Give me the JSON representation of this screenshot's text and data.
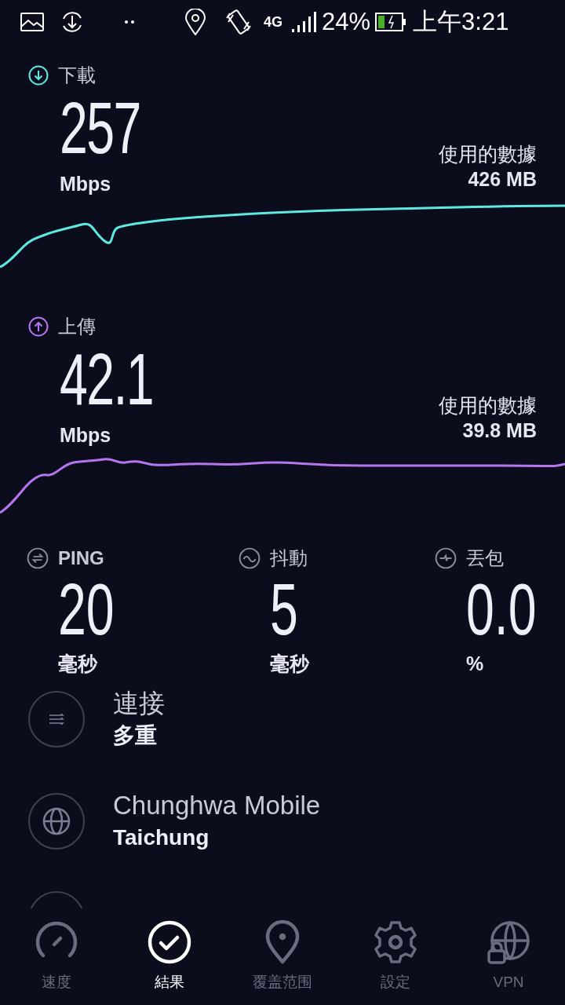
{
  "status_bar": {
    "network": "4G",
    "battery_percent": "24%",
    "time": "上午3:21"
  },
  "download": {
    "label": "下載",
    "value": "257",
    "unit": "Mbps",
    "data_label": "使用的數據",
    "data_value": "426 MB"
  },
  "upload": {
    "label": "上傳",
    "value": "42.1",
    "unit": "Mbps",
    "data_label": "使用的數據",
    "data_value": "39.8 MB"
  },
  "stats": [
    {
      "kind": "ping",
      "label": "PING",
      "value": "20",
      "unit": "毫秒"
    },
    {
      "kind": "jitter",
      "label": "抖動",
      "value": "5",
      "unit": "毫秒"
    },
    {
      "kind": "loss",
      "label": "丟包",
      "value": "0.0",
      "unit": "%"
    }
  ],
  "details": [
    {
      "kind": "connections",
      "title": "連接",
      "value": "多重"
    },
    {
      "kind": "provider",
      "title": "Chunghwa Mobile",
      "value": "Taichung"
    }
  ],
  "nav": [
    {
      "kind": "speed",
      "label": "速度",
      "selected": false
    },
    {
      "kind": "results",
      "label": "結果",
      "selected": true
    },
    {
      "kind": "coverage",
      "label": "覆盖范围",
      "selected": false
    },
    {
      "kind": "settings",
      "label": "設定",
      "selected": false
    },
    {
      "kind": "vpn",
      "label": "VPN",
      "selected": false
    }
  ]
}
